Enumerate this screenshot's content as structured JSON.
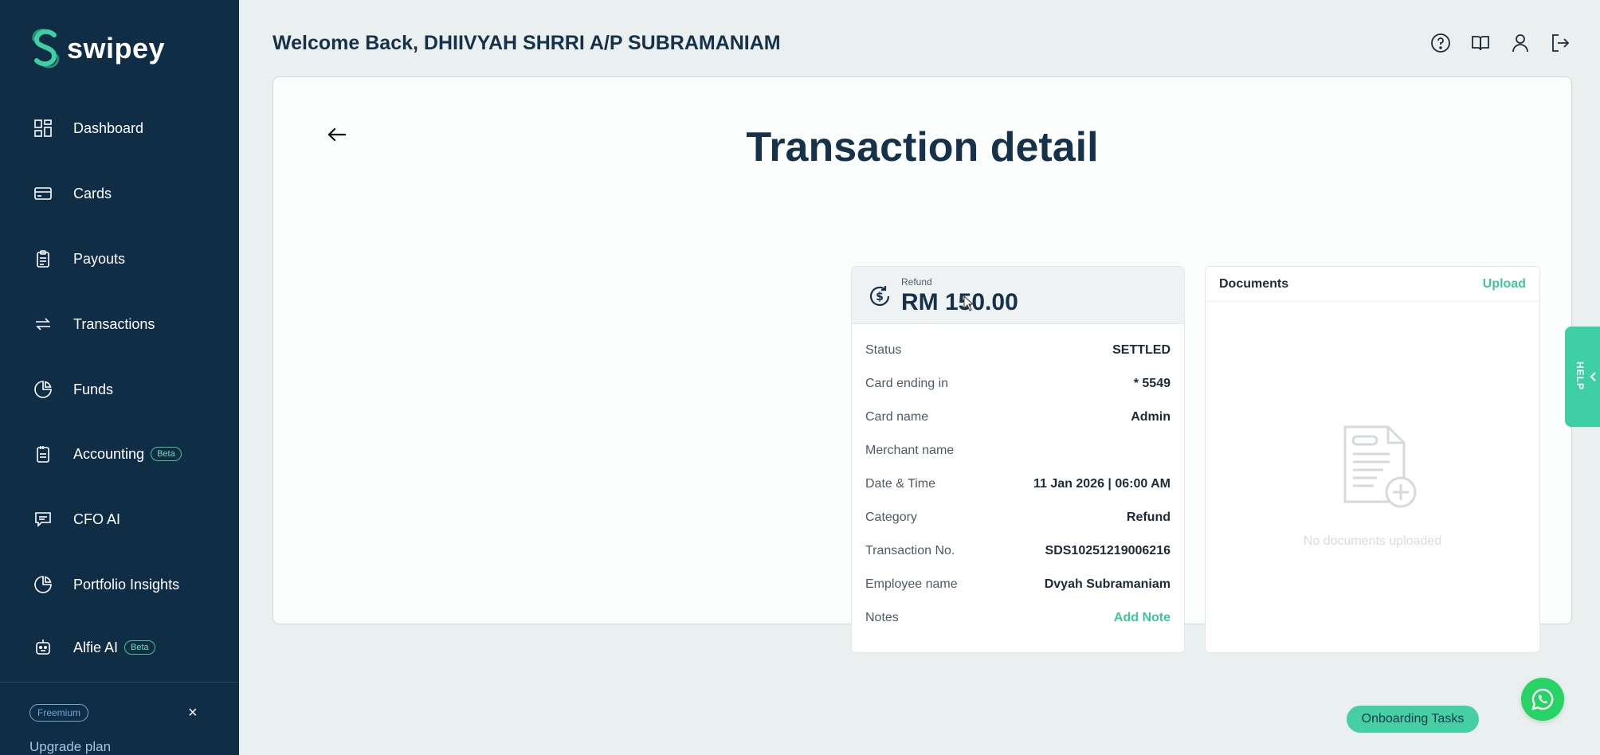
{
  "app": {
    "brand": "swipey"
  },
  "sidebar": {
    "items": [
      {
        "label": "Dashboard",
        "icon": "grid-icon"
      },
      {
        "label": "Cards",
        "icon": "card-icon"
      },
      {
        "label": "Payouts",
        "icon": "clipboard-icon"
      },
      {
        "label": "Transactions",
        "icon": "transfer-arrows-icon"
      },
      {
        "label": "Funds",
        "icon": "pie-chart-icon"
      },
      {
        "label": "Accounting",
        "icon": "accounting-icon",
        "badge": "Beta"
      },
      {
        "label": "CFO AI",
        "icon": "chat-icon"
      },
      {
        "label": "Portfolio Insights",
        "icon": "pie-chart-icon"
      },
      {
        "label": "Alfie AI",
        "icon": "robot-icon",
        "badge": "Beta"
      }
    ],
    "plan_badge": "Freemium",
    "upgrade_label": "Upgrade plan",
    "close_symbol": "×"
  },
  "header": {
    "welcome": "Welcome Back, DHIIVYAH SHRRI A/P SUBRAMANIAM",
    "icons": [
      "help-icon",
      "book-icon",
      "user-icon",
      "logout-icon"
    ]
  },
  "page": {
    "title": "Transaction detail"
  },
  "transaction": {
    "type_label": "Refund",
    "amount": "RM 150.00",
    "rows": [
      {
        "label": "Status",
        "value": "SETTLED"
      },
      {
        "label": "Card ending in",
        "value": "* 5549"
      },
      {
        "label": "Card name",
        "value": "Admin"
      },
      {
        "label": "Merchant name",
        "value": ""
      },
      {
        "label": "Date & Time",
        "value": "11 Jan 2026 | 06:00 AM"
      },
      {
        "label": "Category",
        "value": "Refund"
      },
      {
        "label": "Transaction No.",
        "value": "SDS10251219006216"
      },
      {
        "label": "Employee name",
        "value": "Dvyah Subramaniam"
      },
      {
        "label": "Notes",
        "value": "Add Note"
      }
    ]
  },
  "documents": {
    "title": "Documents",
    "upload_label": "Upload",
    "empty_text": "No documents uploaded"
  },
  "help_tab": {
    "label": "HELP"
  },
  "onboarding": {
    "label": "Onboarding Tasks"
  },
  "colors": {
    "sidebar_bg": "#0f2d45",
    "accent": "#3ec79b",
    "whatsapp": "#28d366",
    "title": "#15324a"
  }
}
